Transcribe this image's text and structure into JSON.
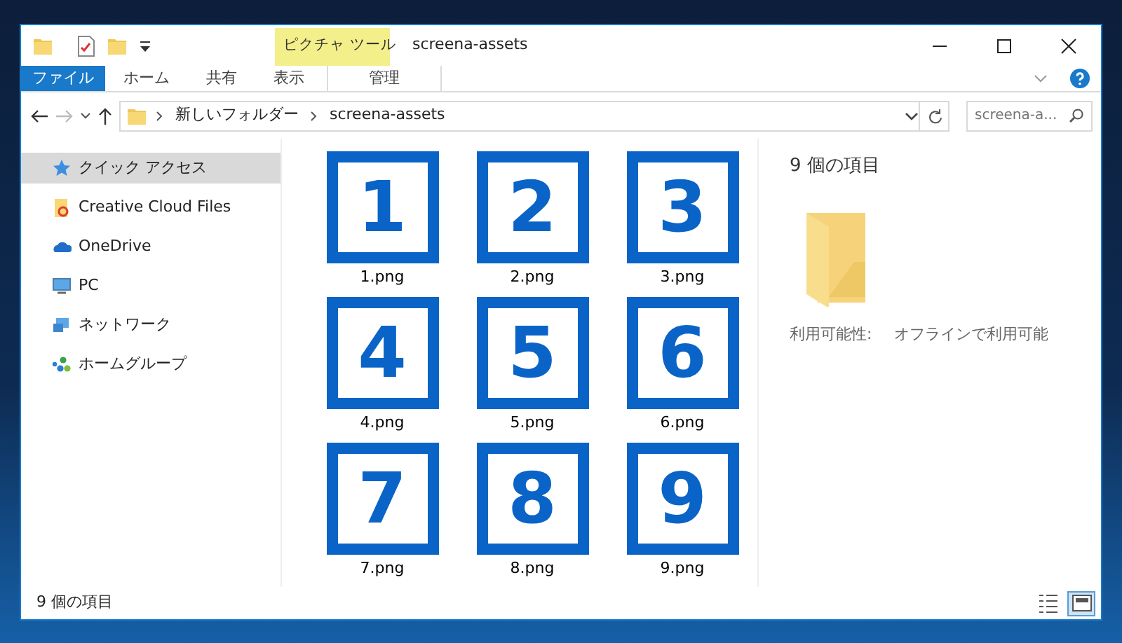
{
  "window": {
    "title": "screena-assets",
    "contextual_tab_group": "ピクチャ ツール"
  },
  "ribbon_tabs": [
    {
      "label": "ファイル",
      "selected": true,
      "kind": "file"
    },
    {
      "label": "ホーム",
      "selected": false,
      "kind": "tab"
    },
    {
      "label": "共有",
      "selected": false,
      "kind": "tab"
    },
    {
      "label": "表示",
      "selected": false,
      "kind": "tab"
    },
    {
      "label": "管理",
      "selected": false,
      "kind": "contextual"
    }
  ],
  "address_bar": {
    "breadcrumbs": [
      "新しいフォルダー",
      "screena-assets"
    ]
  },
  "search": {
    "placeholder": "screena-a..."
  },
  "navigation": [
    {
      "label": "クイック アクセス",
      "selected": true,
      "kind": "star"
    },
    {
      "label": "Creative Cloud Files",
      "selected": false,
      "kind": "cloud-folder"
    },
    {
      "label": "OneDrive",
      "selected": false,
      "kind": "cloud"
    },
    {
      "label": "PC",
      "selected": false,
      "kind": "pc"
    },
    {
      "label": "ネットワーク",
      "selected": false,
      "kind": "network"
    },
    {
      "label": "ホームグループ",
      "selected": false,
      "kind": "homegroup"
    }
  ],
  "files": [
    {
      "name": "1.png",
      "thumbnail_text": "1"
    },
    {
      "name": "2.png",
      "thumbnail_text": "2"
    },
    {
      "name": "3.png",
      "thumbnail_text": "3"
    },
    {
      "name": "4.png",
      "thumbnail_text": "4"
    },
    {
      "name": "5.png",
      "thumbnail_text": "5"
    },
    {
      "name": "6.png",
      "thumbnail_text": "6"
    },
    {
      "name": "7.png",
      "thumbnail_text": "7"
    },
    {
      "name": "8.png",
      "thumbnail_text": "8"
    },
    {
      "name": "9.png",
      "thumbnail_text": "9"
    }
  ],
  "details_pane": {
    "item_count": "9 個の項目",
    "property_label": "利用可能性:",
    "property_value": "オフラインで利用可能"
  },
  "status_bar": {
    "item_count": "9 個の項目",
    "views": [
      {
        "kind": "details",
        "selected": false
      },
      {
        "kind": "large-icons",
        "selected": true
      }
    ]
  }
}
